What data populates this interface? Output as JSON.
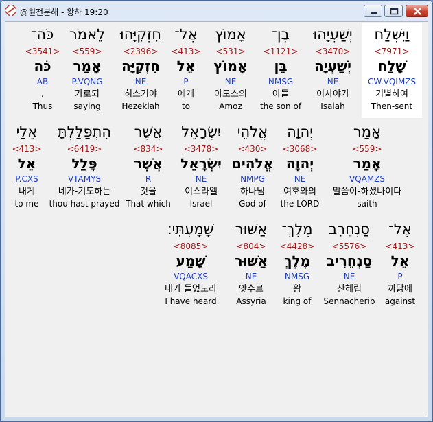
{
  "window": {
    "title": "@원전분해 - 왕하 19:20"
  },
  "rows": [
    [
      {
        "hebrew": "וַיִּשְׁלַח",
        "strong": "<7971>",
        "lemma": "שָׁלַח",
        "morph": "CW.VQIMZS",
        "korean": "기별하여",
        "english": "Then-sent"
      },
      {
        "hebrew": "יְשַׁעְיָהוּ",
        "strong": "<3470>",
        "lemma": "יְשַׁעְיָה",
        "morph": "NE",
        "korean": "이사야가",
        "english": "Isaiah"
      },
      {
        "hebrew": "בֶן־",
        "strong": "<1121>",
        "lemma": "בֵּן",
        "morph": "NMSG",
        "korean": "아들",
        "english": "the son of"
      },
      {
        "hebrew": "אָמוֹץ",
        "strong": "<531>",
        "lemma": "אָמוֹץ",
        "morph": "NE",
        "korean": "아모스의",
        "english": "Amoz"
      },
      {
        "hebrew": "אֶל־",
        "strong": "<413>",
        "lemma": "אֵל",
        "morph": "P",
        "korean": "에게",
        "english": "to"
      },
      {
        "hebrew": "חִזְקִיָּהוּ",
        "strong": "<2396>",
        "lemma": "חִזְקִיָּה",
        "morph": "NE",
        "korean": "히스기야",
        "english": "Hezekiah"
      },
      {
        "hebrew": "לֵאמֹר",
        "strong": "<559>",
        "lemma": "אָמַר",
        "morph": "P.VQNG",
        "korean": "가로되",
        "english": "saying"
      },
      {
        "hebrew": "כֹּה־",
        "strong": "<3541>",
        "lemma": "כֹּה",
        "morph": "AB",
        "korean": ".",
        "english": "Thus"
      }
    ],
    [
      {
        "hebrew": "אָמַר",
        "strong": "<559>",
        "lemma": "אָמַר",
        "morph": "VQAMZS",
        "korean": "말씀이-하셨나이다",
        "english": "saith"
      },
      {
        "hebrew": "יְהוָה",
        "strong": "<3068>",
        "lemma": "יְהוָה",
        "morph": "NE",
        "korean": "여호와의",
        "english": "the LORD"
      },
      {
        "hebrew": "אֱלֹהֵי",
        "strong": "<430>",
        "lemma": "אֱלֹהִים",
        "morph": "NMPG",
        "korean": "하나님",
        "english": "God of"
      },
      {
        "hebrew": "יִשְׂרָאֵל",
        "strong": "<3478>",
        "lemma": "יִשְׂרָאֵל",
        "morph": "NE",
        "korean": "이스라엘",
        "english": "Israel"
      },
      {
        "hebrew": "אֲשֶׁר",
        "strong": "<834>",
        "lemma": "אֲשֶׁר",
        "morph": "R",
        "korean": "것을",
        "english": "That which"
      },
      {
        "hebrew": "הִתְפַּלַּלְתָּ",
        "strong": "<6419>",
        "lemma": "פָּלַל",
        "morph": "VTAMYS",
        "korean": "네가-기도하는",
        "english": "thou hast prayed"
      },
      {
        "hebrew": "אֵלַי",
        "strong": "<413>",
        "lemma": "אֵל",
        "morph": "P.CXS",
        "korean": "내게",
        "english": "to me"
      }
    ],
    [
      {
        "hebrew": "אֶל־",
        "strong": "<413>",
        "lemma": "אֵל",
        "morph": "P",
        "korean": "까닭에",
        "english": "against"
      },
      {
        "hebrew": "סַנְחֵרִב",
        "strong": "<5576>",
        "lemma": "סַנְחֵרִיב",
        "morph": "NE",
        "korean": "산헤립",
        "english": "Sennacherib"
      },
      {
        "hebrew": "מֶלֶךְ־",
        "strong": "<4428>",
        "lemma": "מֶלֶךְ",
        "morph": "NMSG",
        "korean": "왕",
        "english": "king of"
      },
      {
        "hebrew": "אַשּׁוּר",
        "strong": "<804>",
        "lemma": "אַשּׁוּר",
        "morph": "NE",
        "korean": "앗수르",
        "english": "Assyria"
      },
      {
        "hebrew": "שָׁמָעְתִּי׃",
        "strong": "<8085>",
        "lemma": "שָׁמַע",
        "morph": "VQACXS",
        "korean": "내가 들었노라",
        "english": "I have heard"
      }
    ]
  ]
}
